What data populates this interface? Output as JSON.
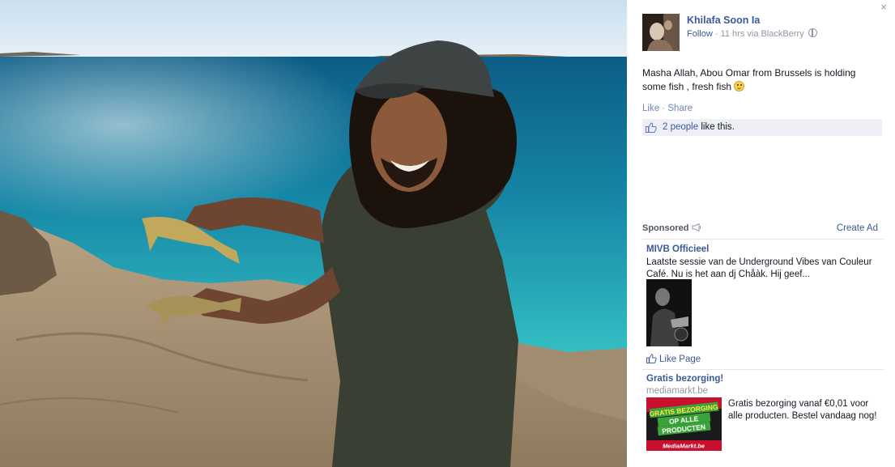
{
  "post": {
    "author": "Khilafa Soon Ia",
    "follow_label": "Follow",
    "meta_text": "· 11 hrs via BlackBerry",
    "caption": "Masha Allah, Abou Omar from Brussels is holding some fish , fresh fish",
    "like_label": "Like",
    "separator": "·",
    "share_label": "Share",
    "likes_link": "2 people",
    "likes_suffix": "like this."
  },
  "sidebar": {
    "close_glyph": "×",
    "sponsored_label": "Sponsored",
    "create_ad_label": "Create Ad"
  },
  "ads": [
    {
      "title": "MIVB Officieel",
      "body": "Laatste sessie van de Underground Vibes van Couleur Café. Nu is het aan dj Chåàk. Hij geef...",
      "action_label": "Like Page"
    },
    {
      "title": "Gratis bezorging!",
      "url": "mediamarkt.be",
      "body": "Gratis bezorging vanaf €0,01 voor alle producten. Bestel vandaag nog!",
      "banner_lines": [
        "GRATIS BEZORGING",
        "OP ALLE",
        "PRODUCTEN"
      ],
      "brand": "MediaMarkt.be"
    }
  ],
  "colors": {
    "link": "#3b5998",
    "muted": "#9197a3",
    "likes_bg": "#edeff4"
  },
  "icons": [
    "close-icon",
    "globe-icon",
    "smiley-icon",
    "thumbs-up-icon",
    "megaphone-icon"
  ]
}
